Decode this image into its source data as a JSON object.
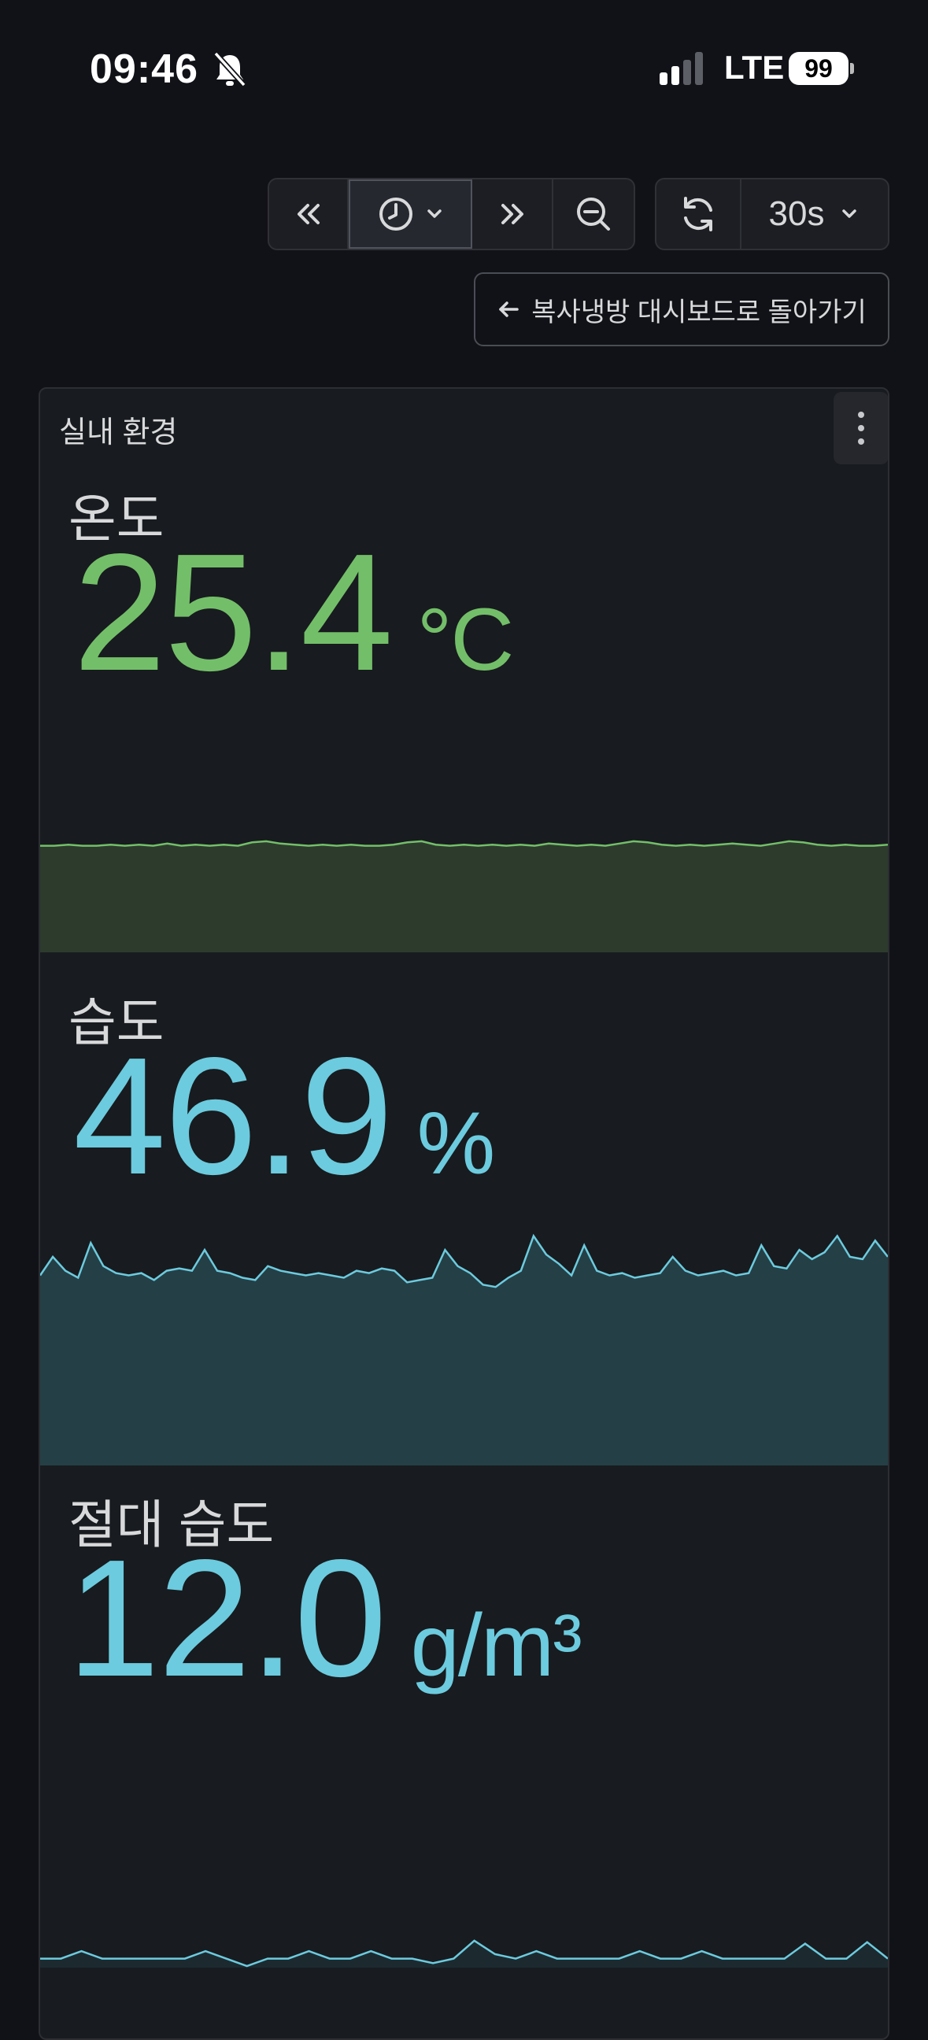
{
  "status_bar": {
    "time": "09:46",
    "network": "LTE",
    "battery": "99"
  },
  "toolbar": {
    "time_range_icons": [
      "chevron-double-left-icon",
      "clock-icon",
      "chevron-double-right-icon",
      "zoom-out-icon"
    ],
    "refresh_interval": "30s",
    "back_link": "복사냉방 대시보드로 돌아가기"
  },
  "panel": {
    "title": "실내 환경",
    "stats": [
      {
        "name": "온도",
        "value": "25.4",
        "unit": "°C",
        "color": "#73bf69",
        "fill": "#2d3b2d",
        "series_level": 0.9,
        "series": [
          0.95,
          0.95,
          0.96,
          0.95,
          0.95,
          0.96,
          0.95,
          0.96,
          0.95,
          0.97,
          0.95,
          0.96,
          0.95,
          0.96,
          0.95,
          0.98,
          0.99,
          0.97,
          0.96,
          0.95,
          0.96,
          0.95,
          0.96,
          0.95,
          0.95,
          0.96,
          0.98,
          0.99,
          0.96,
          0.95,
          0.96,
          0.95,
          0.96,
          0.95,
          0.96,
          0.95,
          0.97,
          0.96,
          0.95,
          0.96,
          0.95,
          0.97,
          0.99,
          0.98,
          0.96,
          0.95,
          0.96,
          0.95,
          0.96,
          0.97,
          0.96,
          0.95,
          0.97,
          0.99,
          0.98,
          0.96,
          0.95,
          0.96,
          0.95,
          0.95,
          0.96
        ]
      },
      {
        "name": "습도",
        "value": "46.9",
        "unit": "%",
        "color": "#6ccbde",
        "fill": "#253f46",
        "series_level": 0.89,
        "series": [
          0.82,
          0.9,
          0.84,
          0.81,
          0.96,
          0.86,
          0.83,
          0.82,
          0.83,
          0.8,
          0.84,
          0.85,
          0.84,
          0.93,
          0.84,
          0.83,
          0.81,
          0.8,
          0.86,
          0.84,
          0.83,
          0.82,
          0.83,
          0.82,
          0.81,
          0.84,
          0.83,
          0.85,
          0.84,
          0.79,
          0.8,
          0.81,
          0.93,
          0.86,
          0.83,
          0.78,
          0.77,
          0.81,
          0.84,
          0.99,
          0.91,
          0.87,
          0.82,
          0.95,
          0.84,
          0.82,
          0.83,
          0.81,
          0.82,
          0.83,
          0.9,
          0.84,
          0.82,
          0.83,
          0.84,
          0.82,
          0.83,
          0.95,
          0.86,
          0.85,
          0.93,
          0.89,
          0.92,
          0.99,
          0.9,
          0.89,
          0.97,
          0.9
        ]
      },
      {
        "name": "절대 습도",
        "value": "12.0",
        "unit": "g/m³",
        "color": "#6ccbde",
        "fill": "#1c2a30",
        "series_level": 0.08,
        "series": [
          0.3,
          0.3,
          0.55,
          0.3,
          0.3,
          0.3,
          0.3,
          0.3,
          0.55,
          0.3,
          0.05,
          0.3,
          0.3,
          0.55,
          0.3,
          0.3,
          0.55,
          0.3,
          0.3,
          0.15,
          0.3,
          0.9,
          0.45,
          0.3,
          0.55,
          0.3,
          0.3,
          0.3,
          0.3,
          0.55,
          0.3,
          0.3,
          0.55,
          0.3,
          0.3,
          0.3,
          0.3,
          0.8,
          0.3,
          0.3,
          0.85,
          0.3
        ]
      }
    ]
  }
}
